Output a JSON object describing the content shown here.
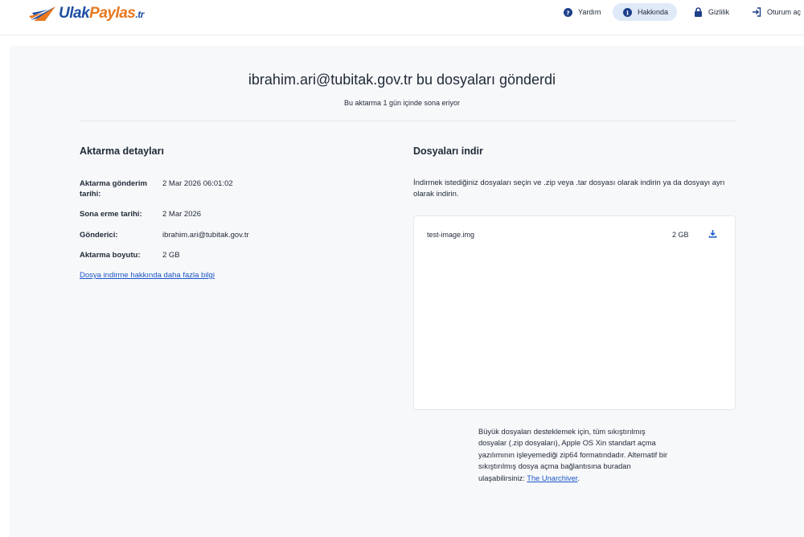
{
  "header": {
    "logo": {
      "ulak": "Ulak",
      "paylas": "Paylas",
      "tr": ".tr"
    },
    "nav": [
      {
        "label": "Yardım",
        "icon": "help-circle-icon"
      },
      {
        "label": "Hakkında",
        "icon": "info-circle-icon",
        "active": true
      },
      {
        "label": "Gizlilik",
        "icon": "lock-icon"
      },
      {
        "label": "Oturum aç",
        "icon": "login-icon"
      }
    ]
  },
  "transfer": {
    "title": "ibrahim.ari@tubitak.gov.tr bu dosyaları gönderdi",
    "expiry_notice": "Bu aktarma 1 gün içinde sona eriyor"
  },
  "details": {
    "heading": "Aktarma detayları",
    "rows": [
      {
        "label": "Aktarma gönderim tarihi:",
        "value": "2 Mar 2026 06:01:02"
      },
      {
        "label": "Sona erme tarihi:",
        "value": "2 Mar 2026"
      },
      {
        "label": "Gönderici:",
        "value": "ibrahim.ari@tubitak.gov.tr"
      },
      {
        "label": "Aktarma boyutu:",
        "value": "2 GB"
      }
    ],
    "more_info_link": "Dosya indirme hakkında daha fazla bilgi"
  },
  "download": {
    "heading": "Dosyaları indir",
    "description": "İndirmek istediğiniz dosyaları seçin ve .zip veya .tar dosyası olarak indirin ya da dosyayı ayrı olarak indirin.",
    "files": [
      {
        "name": "test-image.img",
        "size": "2 GB"
      }
    ],
    "note_text": "Büyük dosyaları desteklemek için, tüm sıkıştırılmış dosyalar (.zip dosyaları), Apple OS Xin standart açma yazılımının işleyemediği zip64 formatındadır. Alternatif bir sıkıştırılmış dosya açma bağlantısına buradan ulaşabilirsiniz: ",
    "note_link": "The Unarchiver",
    "note_end": "."
  },
  "colors": {
    "accent_blue": "#1e4fa3",
    "accent_orange": "#e8781f",
    "link": "#1a56c7",
    "nav_active_bg": "#dfe9f7",
    "panel_bg": "#f7f8fa"
  }
}
